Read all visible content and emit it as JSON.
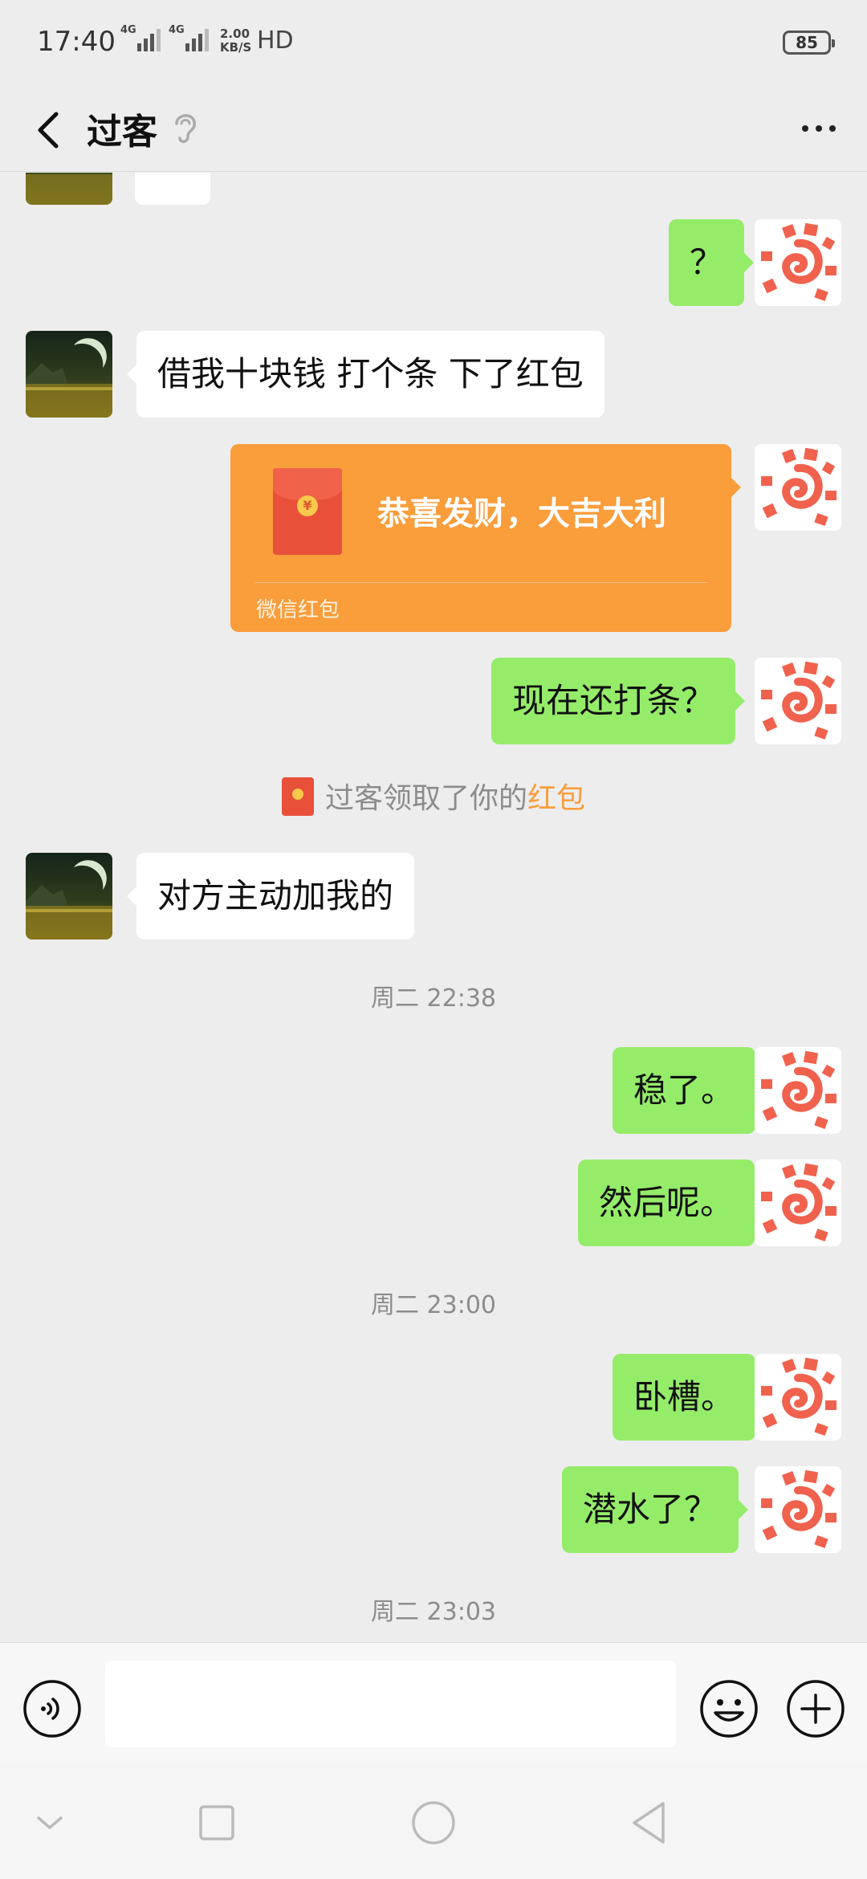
{
  "status_bar": {
    "time": "17:40",
    "signal1_label": "4G",
    "signal2_label": "4G",
    "speed_value": "2.00",
    "speed_unit": "KB/S",
    "hd_label": "HD",
    "battery": "85"
  },
  "header": {
    "title": "过客",
    "icons": [
      "back-arrow-icon",
      "ear-icon",
      "more-icon"
    ]
  },
  "messages": [
    {
      "side": "out",
      "text": "？"
    },
    {
      "side": "in",
      "text": "借我十块钱  打个条  下了红包"
    },
    {
      "side": "out",
      "type": "red_packet",
      "title": "恭喜发财，大吉大利",
      "label": "微信红包"
    },
    {
      "side": "out",
      "text": "现在还打条？"
    },
    {
      "side": "system",
      "text": "过客领取了你的",
      "link": "红包"
    },
    {
      "side": "in",
      "text": "对方主动加我的"
    },
    {
      "side": "time",
      "text": "周二 22:38"
    },
    {
      "side": "out",
      "text": "稳了。"
    },
    {
      "side": "out",
      "text": "然后呢。"
    },
    {
      "side": "time",
      "text": "周二 23:00"
    },
    {
      "side": "out",
      "text": "卧槽。"
    },
    {
      "side": "out",
      "text": "潜水了？"
    },
    {
      "side": "time",
      "text": "周二 23:03"
    }
  ],
  "input_bar": {
    "placeholder": "",
    "icons": [
      "voice-icon",
      "emoji-icon",
      "plus-icon"
    ]
  },
  "nav_bar": {
    "icons": [
      "nav-hide-icon",
      "nav-recents-icon",
      "nav-home-icon",
      "nav-back-icon"
    ]
  },
  "colors": {
    "background": "#ededed",
    "outgoing_bubble": "#95ec69",
    "incoming_bubble": "#ffffff",
    "red_packet": "#fa9d3b",
    "link": "#fa9d3b"
  }
}
